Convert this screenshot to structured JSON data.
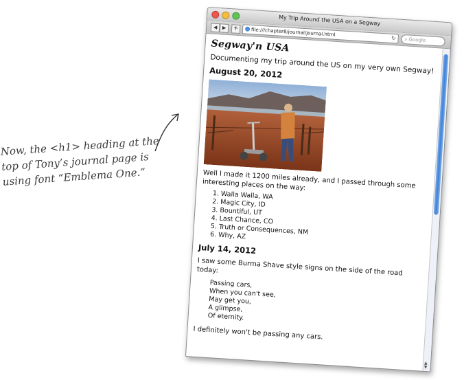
{
  "annotation": {
    "lines": [
      "Now, the <h1> heading at the",
      "top of Tony’s journal page is",
      "using font “Emblema One.”"
    ]
  },
  "browser": {
    "title": "My Trip Around the USA on a Segway",
    "url": "file:///chapter8/journal/journal.html",
    "search_placeholder": "Google",
    "back_glyph": "◀",
    "forward_glyph": "▶",
    "add_glyph": "+",
    "reload_glyph": "↻"
  },
  "page": {
    "heading": "Segway'n USA",
    "intro": "Documenting my trip around the US on my very own Segway!",
    "entries": [
      {
        "date": "August 20, 2012",
        "text": "Well I made it 1200 miles already, and I passed through some interesting places on the way:",
        "places": [
          "Walla Walla, WA",
          "Magic City, ID",
          "Bountiful, UT",
          "Last Chance, CO",
          "Truth or Consequences, NM",
          "Why, AZ"
        ]
      },
      {
        "date": "July 14, 2012",
        "text": "I saw some Burma Shave style signs on the side of the road today:",
        "poem": [
          "Passing cars,",
          "When you can't see,",
          "May get you,",
          "A glimpse,",
          "Of eternity."
        ],
        "closing": "I definitely won't be passing any cars."
      }
    ]
  },
  "icons": {
    "globe": "globe-icon",
    "reload": "reload-icon",
    "search": "search-icon"
  },
  "colors": {
    "close": "#f0574e",
    "minimize": "#f6bd3b",
    "zoom": "#5fc455",
    "scroll_thumb": "#3f80d8"
  }
}
